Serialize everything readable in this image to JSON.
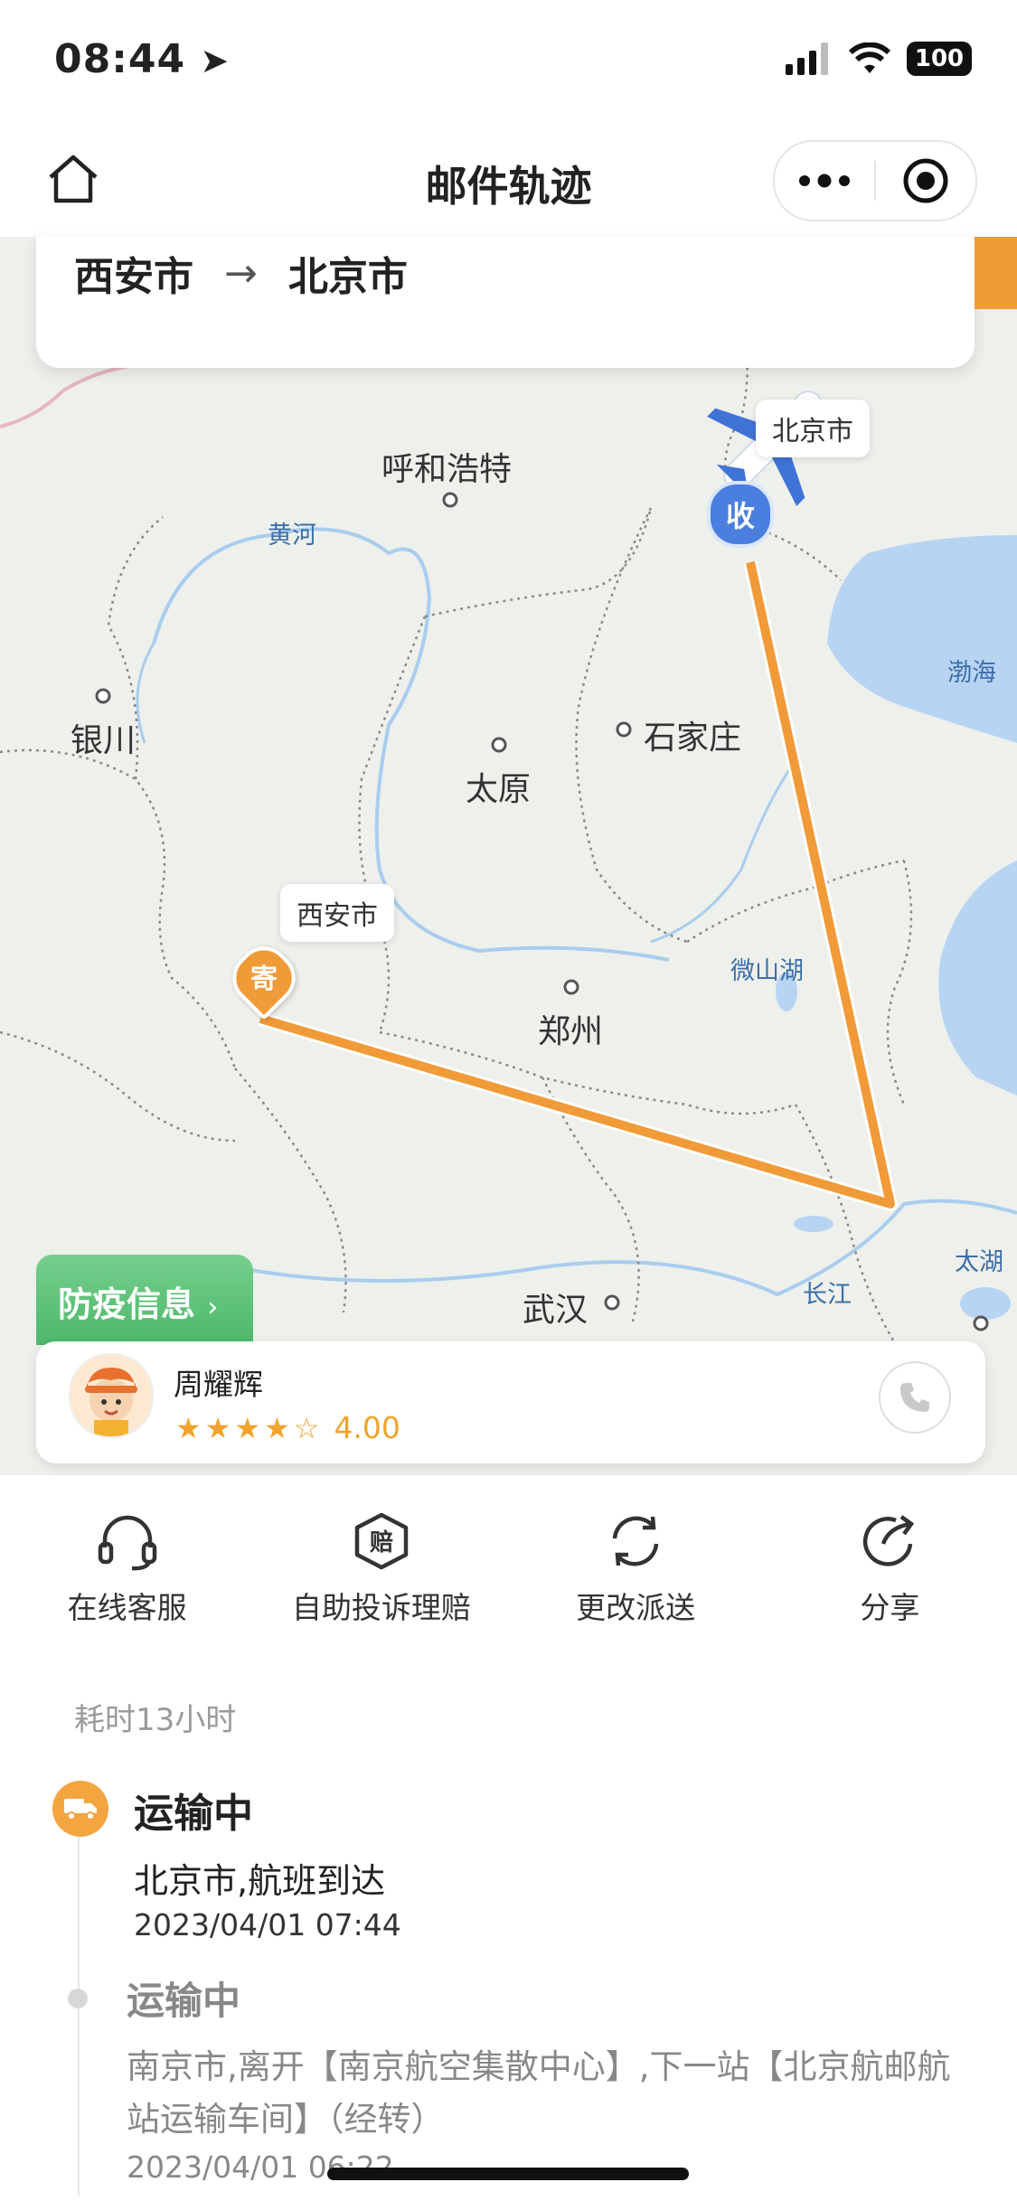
{
  "status_bar": {
    "time": "08:44",
    "battery": "100"
  },
  "header": {
    "title": "邮件轨迹"
  },
  "route": {
    "from": "西安市",
    "arrow": "→",
    "to": "北京市"
  },
  "map": {
    "cities": [
      "呼和浩特",
      "银川",
      "太原",
      "石家庄",
      "郑州",
      "武汉"
    ],
    "water": [
      "黄河",
      "渤海",
      "微山湖",
      "长江",
      "太湖"
    ],
    "origin_bubble": "西安市",
    "dest_bubble": "北京市",
    "origin_marker": "寄",
    "dest_marker": "收",
    "route_color": "#f19a38"
  },
  "epidemic_button": {
    "label": "防疫信息",
    "chevron": "›"
  },
  "courier": {
    "name": "周耀辉",
    "rating": "4.00",
    "stars_filled": 4,
    "stars_total": 5
  },
  "actions": [
    {
      "label": "在线客服",
      "icon": "headset-icon"
    },
    {
      "label": "自助投诉理赔",
      "icon": "compensation-icon"
    },
    {
      "label": "更改派送",
      "icon": "refresh-icon"
    },
    {
      "label": "分享",
      "icon": "share-icon"
    }
  ],
  "timeline": {
    "elapsed": "耗时13小时",
    "events": [
      {
        "status": "运输中",
        "location": "北京市,航班到达",
        "time": "2023/04/01 07:44"
      },
      {
        "status": "运输中",
        "location": "南京市,离开【南京航空集散中心】,下一站【北京航邮航站运输车间】（经转）",
        "time": "2023/04/01 06:22"
      }
    ]
  },
  "colors": {
    "accent": "#f19a38",
    "green": "#4db86a",
    "blue_marker": "#4a7fe0"
  }
}
